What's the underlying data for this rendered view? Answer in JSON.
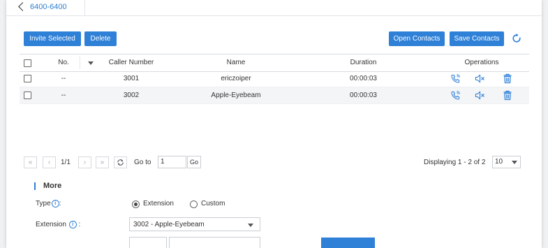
{
  "tab": {
    "label": "6400-6400"
  },
  "toolbar": {
    "invite_selected": "Invite Selected",
    "delete": "Delete",
    "open_contacts": "Open Contacts",
    "save_contacts": "Save Contacts"
  },
  "table": {
    "headers": {
      "no": "No.",
      "caller_number": "Caller Number",
      "name": "Name",
      "duration": "Duration",
      "operations": "Operations"
    },
    "rows": [
      {
        "no": "--",
        "caller_number": "3001",
        "name": "ericzoiper",
        "duration": "00:00:03"
      },
      {
        "no": "--",
        "caller_number": "3002",
        "name": "Apple-Eyebeam",
        "duration": "00:00:03"
      }
    ]
  },
  "pager": {
    "page": "1/1",
    "goto_label": "Go to",
    "goto_value": "1",
    "go_button": "Go",
    "displaying": "Displaying 1 - 2 of 2",
    "per_page": "10"
  },
  "more": {
    "title": "More",
    "type_label": "Type",
    "type_suffix": ":",
    "type_options": [
      "Extension",
      "Custom"
    ],
    "type_selected": "Extension",
    "extension_label": "Extension",
    "extension_suffix": ":",
    "extension_value": "3002 - Apple-Eyebeam"
  },
  "colors": {
    "accent": "#2f80d7",
    "link": "#2c7fd1"
  },
  "icons": [
    "back-chevron-icon",
    "refresh-icon",
    "sort-down-icon",
    "call-icon",
    "mute-icon",
    "trash-icon",
    "info-icon",
    "dropdown-arrow-icon"
  ]
}
